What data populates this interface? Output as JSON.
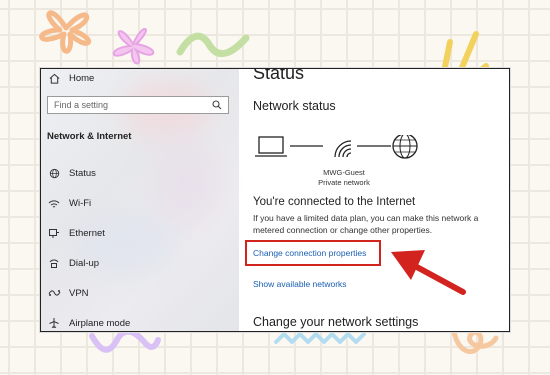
{
  "sidebar": {
    "home_label": "Home",
    "search_placeholder": "Find a setting",
    "category": "Network & Internet",
    "items": [
      {
        "label": "Status"
      },
      {
        "label": "Wi-Fi"
      },
      {
        "label": "Ethernet"
      },
      {
        "label": "Dial-up"
      },
      {
        "label": "VPN"
      },
      {
        "label": "Airplane mode"
      }
    ]
  },
  "main": {
    "title": "Status",
    "subtitle": "Network status",
    "network_name": "MWG-Guest",
    "network_type": "Private network",
    "connected_heading": "You're connected to the Internet",
    "description": "If you have a limited data plan, you can make this network a metered connection or change other properties.",
    "change_link": "Change connection properties",
    "show_link": "Show available networks",
    "settings_heading": "Change your network settings"
  },
  "icons": {
    "home": "home-icon",
    "search": "search-icon",
    "status": "globe-icon",
    "wifi": "wifi-icon",
    "ethernet": "ethernet-icon",
    "dialup": "dialup-icon",
    "vpn": "vpn-icon",
    "airplane": "airplane-icon",
    "laptop": "laptop-icon",
    "globe": "globe-icon"
  },
  "colors": {
    "link": "#1a5fb4",
    "highlight": "#d3231f",
    "arrow": "#d3231f"
  }
}
